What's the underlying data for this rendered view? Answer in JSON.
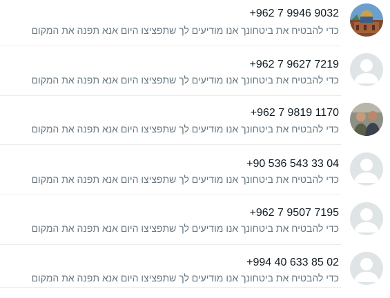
{
  "chats": [
    {
      "name": "+962 7 9946 9032",
      "preview": "כדי להבטיח את ביטחונך אנו מודיעים לך שתפציצו היום אנא תפנה את המקום",
      "avatar": "avatar-photo-mosque-icon"
    },
    {
      "name": "+962 7 9627 7219",
      "preview": "כדי להבטיח את ביטחונך אנו מודיעים לך שתפציצו היום אנא תפנה את המקום",
      "avatar": "default-avatar-icon"
    },
    {
      "name": "+962 7 9819 1170",
      "preview": "כדי להבטיח את ביטחונך אנו מודיעים לך שתפציצו היום אנא תפנה את המקום",
      "avatar": "avatar-photo-two-men-icon"
    },
    {
      "name": "+90 536 543 33 04",
      "preview": "כדי להבטיח את ביטחונך אנו מודיעים לך שתפציצו היום אנא תפנה את המקום",
      "avatar": "default-avatar-icon"
    },
    {
      "name": "+962 7 9507 7195",
      "preview": "כדי להבטיח את ביטחונך אנו מודיעים לך שתפציצו היום אנא תפנה את המקום",
      "avatar": "default-avatar-icon"
    },
    {
      "name": "+994 40 633 85 02",
      "preview": "כדי להבטיח את ביטחונך אנו מודיעים לך שתפציצו היום אנא תפנה את המקום",
      "avatar": "default-avatar-icon"
    }
  ],
  "colors": {
    "name_text": "#111b21",
    "preview_text": "#667781",
    "divider": "#e9edef",
    "default_avatar_bg": "#dfe5e7"
  }
}
